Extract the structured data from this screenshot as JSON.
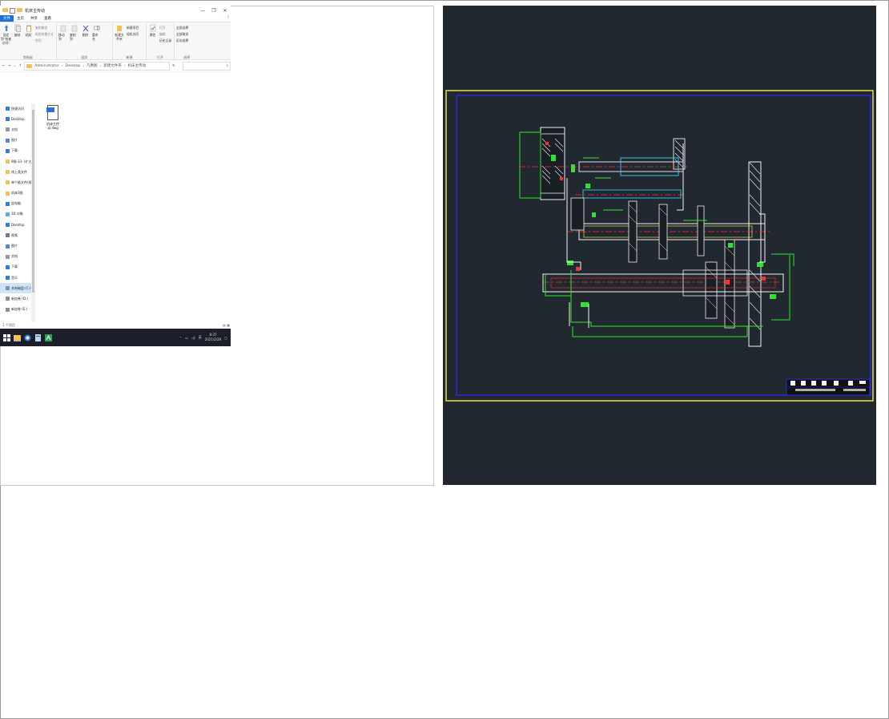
{
  "explorer": {
    "window_title": "机床主传动",
    "window_buttons": [
      "—",
      "❐",
      "✕"
    ],
    "ribbon_tabs": [
      "文件",
      "主页",
      "共享",
      "查看"
    ],
    "help": "?",
    "ribbon": {
      "clipboard": {
        "pin": "固定到\"快速访问\"",
        "copy": "复制",
        "paste": "粘贴",
        "copy_path": "复制路径",
        "paste_shortcut": "粘贴快捷方式",
        "cut": "剪切",
        "group": "剪贴板"
      },
      "organize": {
        "move_to": "移动到",
        "copy_to": "复制到",
        "delete": "删除",
        "rename": "重命名",
        "group": "组织"
      },
      "new": {
        "new_folder": "新建文件夹",
        "new_item": "新建项目",
        "easy_access": "轻松访问",
        "group": "新建"
      },
      "open": {
        "properties": "属性",
        "open": "打开",
        "edit": "编辑",
        "history": "历史记录",
        "group": "打开"
      },
      "select": {
        "select_all": "全部选择",
        "select_none": "全部取消",
        "invert": "反向选择",
        "group": "选择"
      }
    },
    "address": {
      "segments": [
        "Administrator",
        "Desktop",
        "凡惠图",
        "新建文件夹",
        "机床主传动"
      ],
      "search_icon": "search-icon"
    },
    "nav": [
      {
        "label": "快速访问",
        "icon": "star-icon"
      },
      {
        "label": "Desktop",
        "icon": "desktop-icon"
      },
      {
        "label": "文档",
        "icon": "document-icon"
      },
      {
        "label": "图片",
        "icon": "picture-icon"
      },
      {
        "label": "下载",
        "icon": "download-icon"
      },
      {
        "label": "9图-33- (扩大) ",
        "icon": "folder-icon"
      },
      {
        "label": "线上类文件",
        "icon": "folder-icon"
      },
      {
        "label": "单个能文件(规划)",
        "icon": "folder-icon"
      },
      {
        "label": "机床3图",
        "icon": "folder-icon"
      },
      {
        "label": "此电脑",
        "icon": "computer-icon"
      },
      {
        "label": "3D 对象",
        "icon": "cube-icon"
      },
      {
        "label": "Desktop",
        "icon": "desktop-icon"
      },
      {
        "label": "视频",
        "icon": "video-icon"
      },
      {
        "label": "图片",
        "icon": "picture-icon"
      },
      {
        "label": "文档",
        "icon": "document-icon"
      },
      {
        "label": "下载",
        "icon": "download-icon"
      },
      {
        "label": "音乐",
        "icon": "music-icon"
      },
      {
        "label": "本地磁盘 (C:)",
        "icon": "drive-icon"
      },
      {
        "label": "新加卷 (D:)",
        "icon": "drive-icon"
      },
      {
        "label": "新加卷 (E:)",
        "icon": "drive-icon"
      }
    ],
    "file": {
      "name_line1": "机床主传",
      "name_line2": "动.dwg",
      "badge": "DWG"
    },
    "status": "1 个项目",
    "taskbar": {
      "time": "8:37",
      "date": "2021/2/29",
      "ime": "英"
    }
  },
  "colors": {
    "accent": "#1e6fd6",
    "taskbar": "#1b1f2a",
    "cad_bg": "#212830",
    "cad_yellow": "#e8e04a",
    "cad_blue": "#2a2ad8",
    "cad_green": "#2ee52e",
    "cad_red": "#ff3030",
    "cad_white": "#f2f2f2",
    "cad_cyan": "#35c8e8"
  }
}
